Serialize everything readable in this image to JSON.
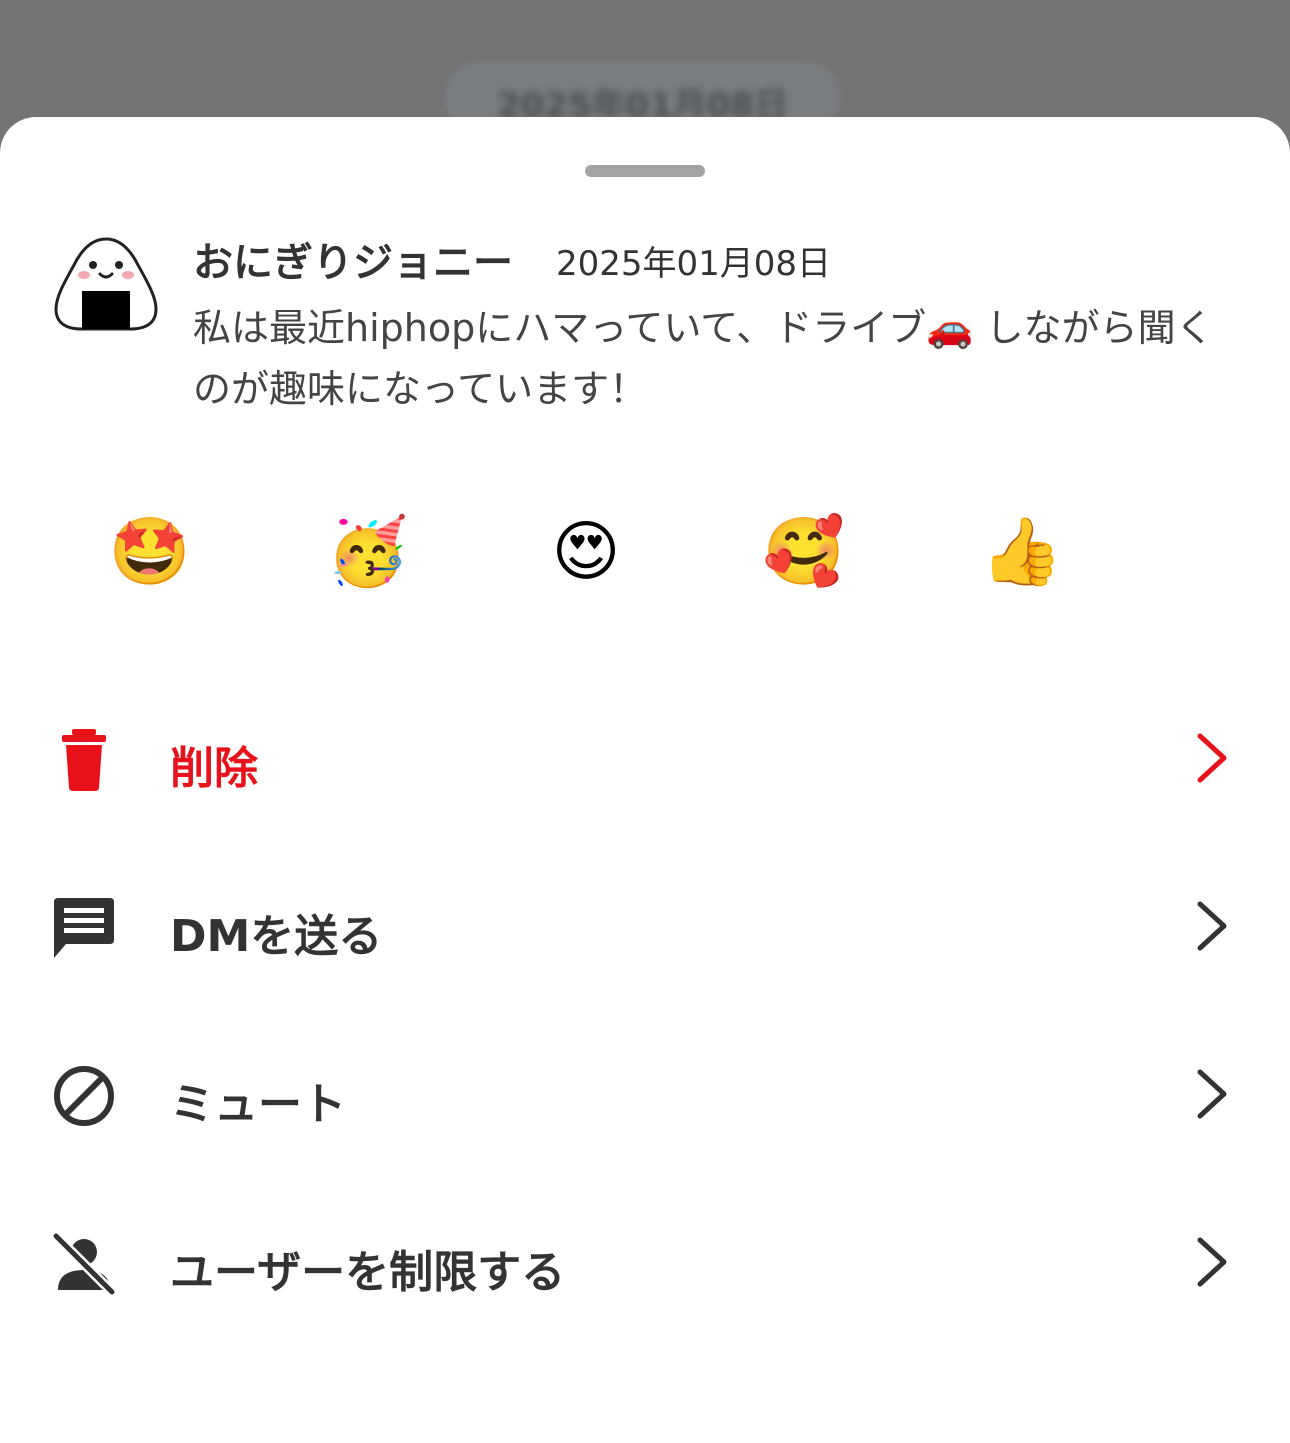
{
  "backdrop": {
    "pill_text": "2025年01月08日"
  },
  "post": {
    "author": "おにぎりジョニー",
    "date": "2025年01月08日",
    "message": "私は最近hiphopにハマっていて、ドライブ🚗 しながら聞くのが趣味になっています！"
  },
  "reactions": [
    {
      "emoji": "🤩",
      "icon": "star-struck"
    },
    {
      "emoji": "🥳",
      "icon": "partying-face"
    },
    {
      "emoji": "😍",
      "icon": "heart-eyes"
    },
    {
      "emoji": "🥰",
      "icon": "smiling-face-with-hearts"
    },
    {
      "emoji": "👍",
      "icon": "thumbs-up"
    }
  ],
  "menu": [
    {
      "label": "削除",
      "icon": "trash-icon",
      "color": "#e8121b"
    },
    {
      "label": "DMを送る",
      "icon": "message-icon",
      "color": "#333333"
    },
    {
      "label": "ミュート",
      "icon": "block-icon",
      "color": "#333333"
    },
    {
      "label": "ユーザーを制限する",
      "icon": "user-off-icon",
      "color": "#333333"
    }
  ],
  "colors": {
    "danger": "#e8121b",
    "text": "#333333",
    "overlay": "#737474"
  }
}
